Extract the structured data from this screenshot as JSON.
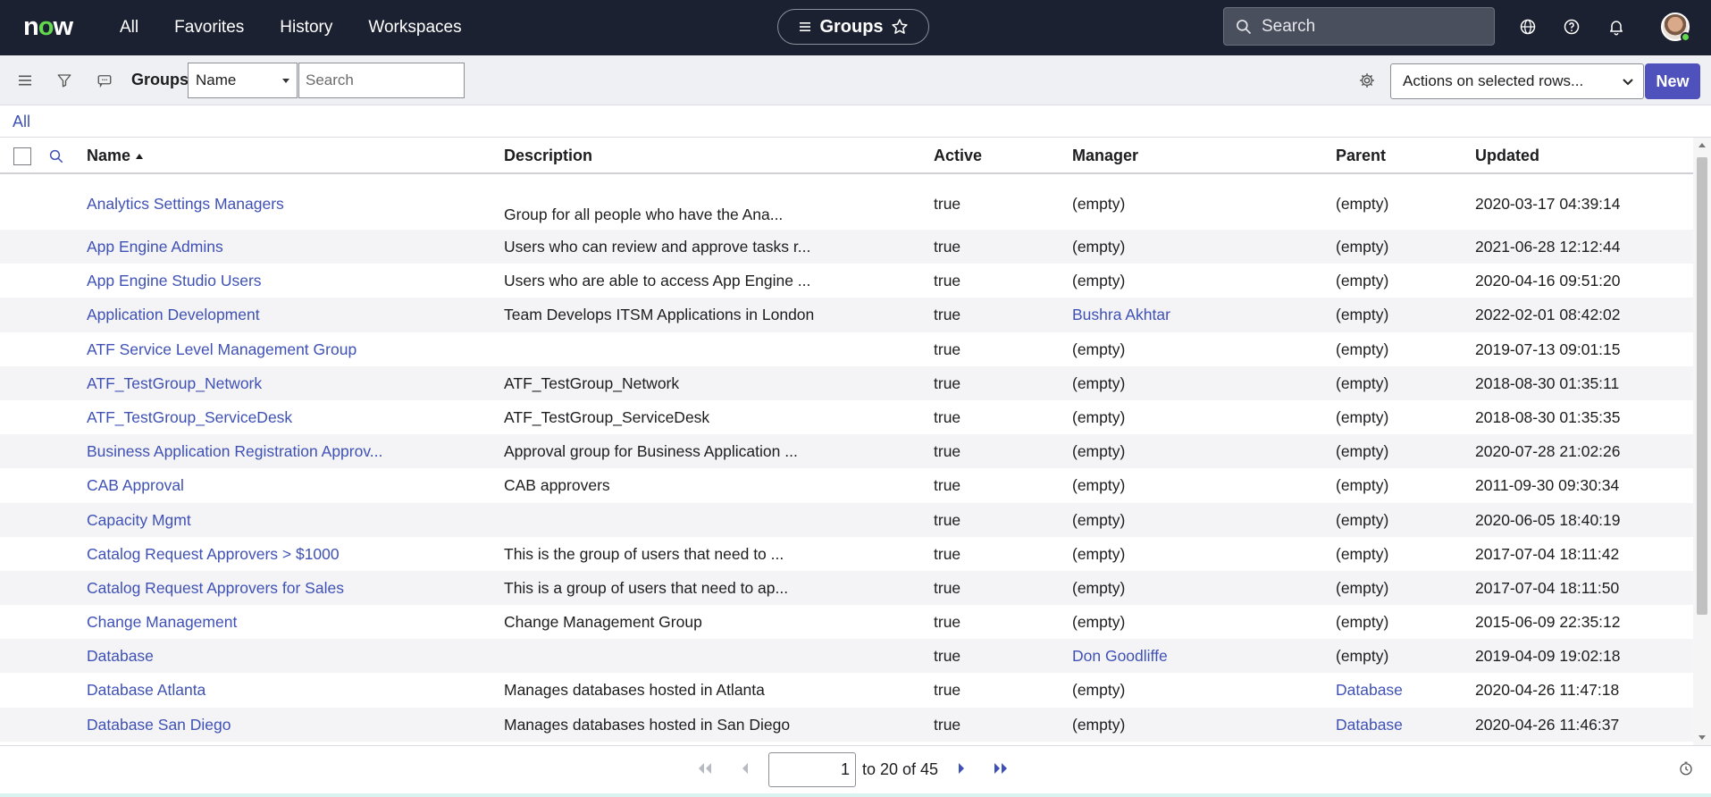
{
  "topnav": {
    "logo": "now",
    "links": [
      "All",
      "Favorites",
      "History",
      "Workspaces"
    ],
    "context_title": "Groups",
    "search_placeholder": "Search"
  },
  "toolbar": {
    "title": "Groups",
    "field_select": "Name",
    "search_placeholder": "Search",
    "actions_label": "Actions on selected rows...",
    "new_label": "New"
  },
  "breadcrumb": "All",
  "columns": {
    "name": "Name",
    "description": "Description",
    "active": "Active",
    "manager": "Manager",
    "parent": "Parent",
    "updated": "Updated"
  },
  "rows": [
    {
      "name": "Analytics Settings Managers",
      "description": "Group for all people who have the Ana...",
      "active": "true",
      "manager": "(empty)",
      "parent": "(empty)",
      "updated": "2020-03-17 04:39:14"
    },
    {
      "name": "App Engine Admins",
      "description": "Users who can review and approve tasks r...",
      "active": "true",
      "manager": "(empty)",
      "parent": "(empty)",
      "updated": "2021-06-28 12:12:44"
    },
    {
      "name": "App Engine Studio Users",
      "description": "Users who are able to access App Engine ...",
      "active": "true",
      "manager": "(empty)",
      "parent": "(empty)",
      "updated": "2020-04-16 09:51:20"
    },
    {
      "name": "Application Development",
      "description": "Team Develops ITSM Applications in London",
      "active": "true",
      "manager": "Bushra Akhtar",
      "parent": "(empty)",
      "updated": "2022-02-01 08:42:02"
    },
    {
      "name": "ATF Service Level Management Group",
      "description": "",
      "active": "true",
      "manager": "(empty)",
      "parent": "(empty)",
      "updated": "2019-07-13 09:01:15"
    },
    {
      "name": "ATF_TestGroup_Network",
      "description": "ATF_TestGroup_Network",
      "active": "true",
      "manager": "(empty)",
      "parent": "(empty)",
      "updated": "2018-08-30 01:35:11"
    },
    {
      "name": "ATF_TestGroup_ServiceDesk",
      "description": "ATF_TestGroup_ServiceDesk",
      "active": "true",
      "manager": "(empty)",
      "parent": "(empty)",
      "updated": "2018-08-30 01:35:35"
    },
    {
      "name": "Business Application Registration Approv...",
      "description": "Approval group for Business Application ...",
      "active": "true",
      "manager": "(empty)",
      "parent": "(empty)",
      "updated": "2020-07-28 21:02:26"
    },
    {
      "name": "CAB Approval",
      "description": "CAB approvers",
      "active": "true",
      "manager": "(empty)",
      "parent": "(empty)",
      "updated": "2011-09-30 09:30:34"
    },
    {
      "name": "Capacity Mgmt",
      "description": "",
      "active": "true",
      "manager": "(empty)",
      "parent": "(empty)",
      "updated": "2020-06-05 18:40:19"
    },
    {
      "name": "Catalog Request Approvers > $1000",
      "description": "This is the group of users that need to ...",
      "active": "true",
      "manager": "(empty)",
      "parent": "(empty)",
      "updated": "2017-07-04 18:11:42"
    },
    {
      "name": "Catalog Request Approvers for Sales",
      "description": "This is a group of users that need to ap...",
      "active": "true",
      "manager": "(empty)",
      "parent": "(empty)",
      "updated": "2017-07-04 18:11:50"
    },
    {
      "name": "Change Management",
      "description": "Change Management Group",
      "active": "true",
      "manager": "(empty)",
      "parent": "(empty)",
      "updated": "2015-06-09 22:35:12"
    },
    {
      "name": "Database",
      "description": "",
      "active": "true",
      "manager": "Don Goodliffe",
      "parent": "(empty)",
      "updated": "2019-04-09 19:02:18"
    },
    {
      "name": "Database Atlanta",
      "description": "Manages databases hosted in Atlanta",
      "active": "true",
      "manager": "(empty)",
      "parent": "Database",
      "updated": "2020-04-26 11:47:18"
    },
    {
      "name": "Database San Diego",
      "description": "Manages databases hosted in San Diego",
      "active": "true",
      "manager": "(empty)",
      "parent": "Database",
      "updated": "2020-04-26 11:46:37"
    }
  ],
  "pagination": {
    "page_value": "1",
    "range_text": "to 20 of 45"
  },
  "colors": {
    "nav_bg": "#1c2131",
    "link": "#3f51b5",
    "primary_button": "#4f52bd",
    "logo_accent": "#62d84e"
  }
}
